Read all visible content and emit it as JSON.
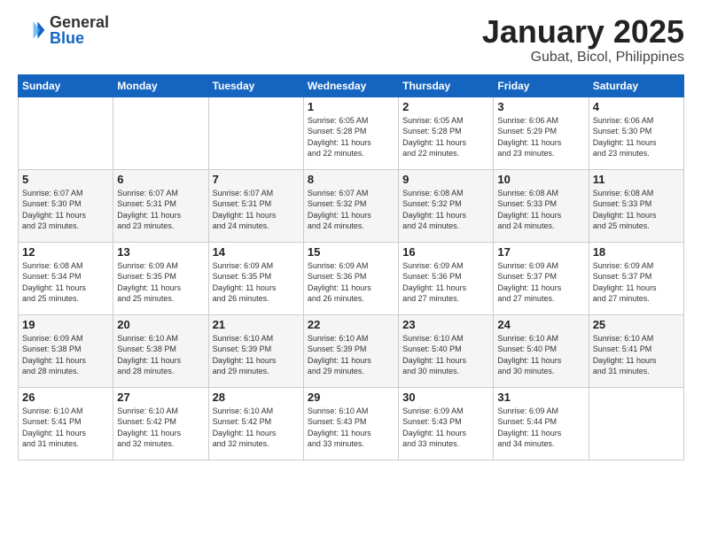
{
  "header": {
    "logo": {
      "general": "General",
      "blue": "Blue"
    },
    "title": "January 2025",
    "subtitle": "Gubat, Bicol, Philippines"
  },
  "weekdays": [
    "Sunday",
    "Monday",
    "Tuesday",
    "Wednesday",
    "Thursday",
    "Friday",
    "Saturday"
  ],
  "weeks": [
    [
      {
        "day": "",
        "info": ""
      },
      {
        "day": "",
        "info": ""
      },
      {
        "day": "",
        "info": ""
      },
      {
        "day": "1",
        "info": "Sunrise: 6:05 AM\nSunset: 5:28 PM\nDaylight: 11 hours\nand 22 minutes."
      },
      {
        "day": "2",
        "info": "Sunrise: 6:05 AM\nSunset: 5:28 PM\nDaylight: 11 hours\nand 22 minutes."
      },
      {
        "day": "3",
        "info": "Sunrise: 6:06 AM\nSunset: 5:29 PM\nDaylight: 11 hours\nand 23 minutes."
      },
      {
        "day": "4",
        "info": "Sunrise: 6:06 AM\nSunset: 5:30 PM\nDaylight: 11 hours\nand 23 minutes."
      }
    ],
    [
      {
        "day": "5",
        "info": "Sunrise: 6:07 AM\nSunset: 5:30 PM\nDaylight: 11 hours\nand 23 minutes."
      },
      {
        "day": "6",
        "info": "Sunrise: 6:07 AM\nSunset: 5:31 PM\nDaylight: 11 hours\nand 23 minutes."
      },
      {
        "day": "7",
        "info": "Sunrise: 6:07 AM\nSunset: 5:31 PM\nDaylight: 11 hours\nand 24 minutes."
      },
      {
        "day": "8",
        "info": "Sunrise: 6:07 AM\nSunset: 5:32 PM\nDaylight: 11 hours\nand 24 minutes."
      },
      {
        "day": "9",
        "info": "Sunrise: 6:08 AM\nSunset: 5:32 PM\nDaylight: 11 hours\nand 24 minutes."
      },
      {
        "day": "10",
        "info": "Sunrise: 6:08 AM\nSunset: 5:33 PM\nDaylight: 11 hours\nand 24 minutes."
      },
      {
        "day": "11",
        "info": "Sunrise: 6:08 AM\nSunset: 5:33 PM\nDaylight: 11 hours\nand 25 minutes."
      }
    ],
    [
      {
        "day": "12",
        "info": "Sunrise: 6:08 AM\nSunset: 5:34 PM\nDaylight: 11 hours\nand 25 minutes."
      },
      {
        "day": "13",
        "info": "Sunrise: 6:09 AM\nSunset: 5:35 PM\nDaylight: 11 hours\nand 25 minutes."
      },
      {
        "day": "14",
        "info": "Sunrise: 6:09 AM\nSunset: 5:35 PM\nDaylight: 11 hours\nand 26 minutes."
      },
      {
        "day": "15",
        "info": "Sunrise: 6:09 AM\nSunset: 5:36 PM\nDaylight: 11 hours\nand 26 minutes."
      },
      {
        "day": "16",
        "info": "Sunrise: 6:09 AM\nSunset: 5:36 PM\nDaylight: 11 hours\nand 27 minutes."
      },
      {
        "day": "17",
        "info": "Sunrise: 6:09 AM\nSunset: 5:37 PM\nDaylight: 11 hours\nand 27 minutes."
      },
      {
        "day": "18",
        "info": "Sunrise: 6:09 AM\nSunset: 5:37 PM\nDaylight: 11 hours\nand 27 minutes."
      }
    ],
    [
      {
        "day": "19",
        "info": "Sunrise: 6:09 AM\nSunset: 5:38 PM\nDaylight: 11 hours\nand 28 minutes."
      },
      {
        "day": "20",
        "info": "Sunrise: 6:10 AM\nSunset: 5:38 PM\nDaylight: 11 hours\nand 28 minutes."
      },
      {
        "day": "21",
        "info": "Sunrise: 6:10 AM\nSunset: 5:39 PM\nDaylight: 11 hours\nand 29 minutes."
      },
      {
        "day": "22",
        "info": "Sunrise: 6:10 AM\nSunset: 5:39 PM\nDaylight: 11 hours\nand 29 minutes."
      },
      {
        "day": "23",
        "info": "Sunrise: 6:10 AM\nSunset: 5:40 PM\nDaylight: 11 hours\nand 30 minutes."
      },
      {
        "day": "24",
        "info": "Sunrise: 6:10 AM\nSunset: 5:40 PM\nDaylight: 11 hours\nand 30 minutes."
      },
      {
        "day": "25",
        "info": "Sunrise: 6:10 AM\nSunset: 5:41 PM\nDaylight: 11 hours\nand 31 minutes."
      }
    ],
    [
      {
        "day": "26",
        "info": "Sunrise: 6:10 AM\nSunset: 5:41 PM\nDaylight: 11 hours\nand 31 minutes."
      },
      {
        "day": "27",
        "info": "Sunrise: 6:10 AM\nSunset: 5:42 PM\nDaylight: 11 hours\nand 32 minutes."
      },
      {
        "day": "28",
        "info": "Sunrise: 6:10 AM\nSunset: 5:42 PM\nDaylight: 11 hours\nand 32 minutes."
      },
      {
        "day": "29",
        "info": "Sunrise: 6:10 AM\nSunset: 5:43 PM\nDaylight: 11 hours\nand 33 minutes."
      },
      {
        "day": "30",
        "info": "Sunrise: 6:09 AM\nSunset: 5:43 PM\nDaylight: 11 hours\nand 33 minutes."
      },
      {
        "day": "31",
        "info": "Sunrise: 6:09 AM\nSunset: 5:44 PM\nDaylight: 11 hours\nand 34 minutes."
      },
      {
        "day": "",
        "info": ""
      }
    ]
  ]
}
